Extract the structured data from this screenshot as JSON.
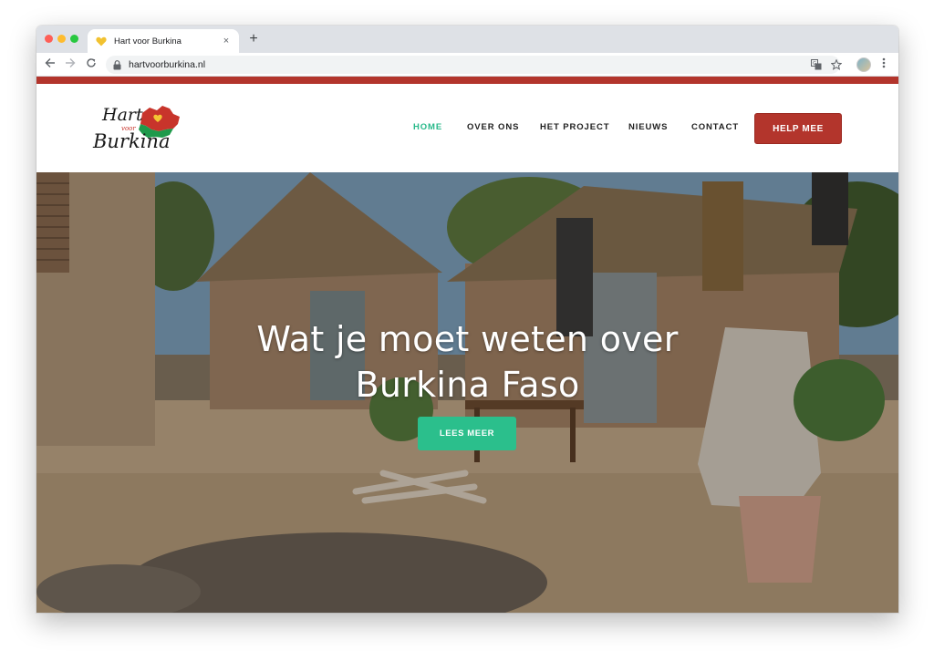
{
  "browser": {
    "tab_title": "Hart voor Burkina",
    "url": "hartvoorburkina.nl",
    "new_tab_symbol": "+",
    "close_symbol": "×",
    "icons": [
      "back-arrow-icon",
      "forward-arrow-icon",
      "reload-icon",
      "lock-icon",
      "translate-icon",
      "bookmark-star-icon",
      "menu-dots-icon"
    ]
  },
  "site": {
    "logo": {
      "text_line1": "Hart",
      "text_small": "voor",
      "text_line2": "Burkina"
    },
    "nav": [
      {
        "label": "HOME",
        "active": true
      },
      {
        "label": "OVER ONS",
        "active": false
      },
      {
        "label": "HET PROJECT",
        "active": false
      },
      {
        "label": "NIEUWS",
        "active": false
      },
      {
        "label": "CONTACT",
        "active": false
      }
    ],
    "help_button": "HELP MEE",
    "hero": {
      "title_line1": "Wat je moet weten over",
      "title_line2": "Burkina Faso",
      "cta": "LEES MEER"
    }
  },
  "colors": {
    "accent_red": "#b3352c",
    "nav_active_green": "#28b98a",
    "cta_green": "#2bbf8c"
  }
}
